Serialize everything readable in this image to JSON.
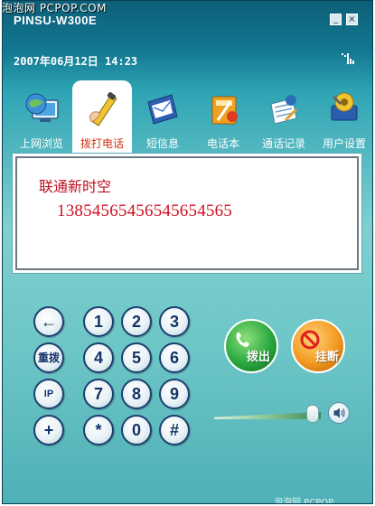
{
  "watermark_top": "泡泡网 PCPOP.COM",
  "window": {
    "title": "PINSU-W300E",
    "minimize_glyph": "_",
    "close_glyph": "×"
  },
  "status": {
    "datetime": "2007年06月12日  14:23",
    "signal_icon": "signal-icon"
  },
  "tabs": [
    {
      "label": "上网浏览",
      "icon": "globe-computer-icon",
      "active": false
    },
    {
      "label": "拨打电话",
      "icon": "phone-handset-icon",
      "active": true
    },
    {
      "label": "短信息",
      "icon": "message-icon",
      "active": false
    },
    {
      "label": "电话本",
      "icon": "contacts-book-icon",
      "active": false
    },
    {
      "label": "通话记录",
      "icon": "call-log-icon",
      "active": false
    },
    {
      "label": "用户设置",
      "icon": "settings-icon",
      "active": false
    }
  ],
  "display": {
    "carrier": "联通新时空",
    "number": "13854565456545654565"
  },
  "keypad": {
    "backspace": "←",
    "redial": "重拨",
    "ip": "IP",
    "plus": "+",
    "k1": "1",
    "k2": "2",
    "k3": "3",
    "k4": "4",
    "k5": "5",
    "k6": "6",
    "k7": "7",
    "k8": "8",
    "k9": "9",
    "star": "*",
    "k0": "0",
    "hash": "#"
  },
  "actions": {
    "call_label": "拨出",
    "hangup_label": "挂断"
  },
  "volume": {
    "level": 0.9,
    "icon": "speaker-icon"
  },
  "watermark_bottom": "泡泡网 PCPOP",
  "colors": {
    "active_tab_label": "#d03010",
    "display_text": "#c01020",
    "key_text": "#13326a",
    "call_button": "#2aa840",
    "hangup_button": "#f39a20"
  }
}
